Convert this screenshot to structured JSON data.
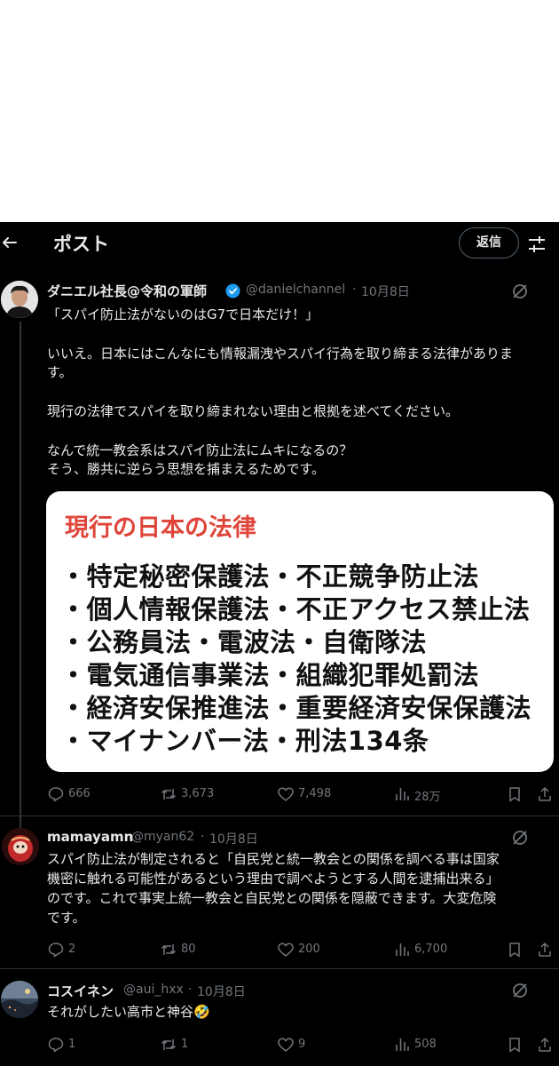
{
  "header": {
    "title": "ポスト",
    "reply_button": "返信"
  },
  "post": {
    "author_name": "ダニエル社長@令和の軍師",
    "handle": "@danielchannel",
    "date": "10月8日",
    "lines": [
      "「スパイ防止法がないのはG7で日本だけ！」",
      "いいえ。日本にはこんなにも情報漏洩やスパイ行為を取り締まる法律がありま",
      "す。",
      "現行の法律でスパイを取り締まれない理由と根拠を述べてください。",
      "なんで統一教会系はスパイ防止法にムキになるの？",
      "そう、勝共に逆らう思想を捕まえるためです。"
    ],
    "card": {
      "title": "現行の日本の法律",
      "items": [
        "・特定秘密保護法・不正競争防止法",
        "・個人情報保護法・不正アクセス禁止法",
        "・公務員法・電波法・自衛隊法",
        "・電気通信事業法・組織犯罪処罰法",
        "・経済安保推進法・重要経済安保保護法",
        "・マイナンバー法・刑法134条"
      ]
    },
    "stats": {
      "replies": "666",
      "reposts": "3,673",
      "likes": "7,498",
      "views": "28万"
    }
  },
  "replies": [
    {
      "author_name": "mamayamn",
      "handle": "@myan62",
      "date": "10月8日",
      "lines": [
        "スパイ防止法が制定されると「自民党と統一教会との関係を調べる事は国家",
        "機密に触れる可能性があるという理由で調べようとする人間を逮捕出来る」",
        "のです。これで事実上統一教会と自民党との関係を隠蔽できます。大変危険",
        "です。"
      ],
      "stats": {
        "replies": "2",
        "reposts": "80",
        "likes": "200",
        "views": "6,700"
      }
    },
    {
      "author_name": "コスイネン",
      "handle": "@aui_hxx",
      "date": "10月8日",
      "lines": [
        "それがしたい高市と神谷🤣"
      ],
      "stats": {
        "replies": "1",
        "reposts": "1",
        "likes": "9",
        "views": "508"
      }
    }
  ],
  "colors": {
    "background": "#000000",
    "text": "#e7e9ea",
    "muted": "#71767b",
    "verified": "#1d9bf0",
    "card_title": "#e0453a"
  },
  "icons": [
    "back-arrow-icon",
    "tune-icon",
    "verified-badge-icon",
    "grok-icon",
    "reply-icon",
    "repost-icon",
    "like-icon",
    "views-icon",
    "bookmark-icon",
    "share-icon"
  ]
}
